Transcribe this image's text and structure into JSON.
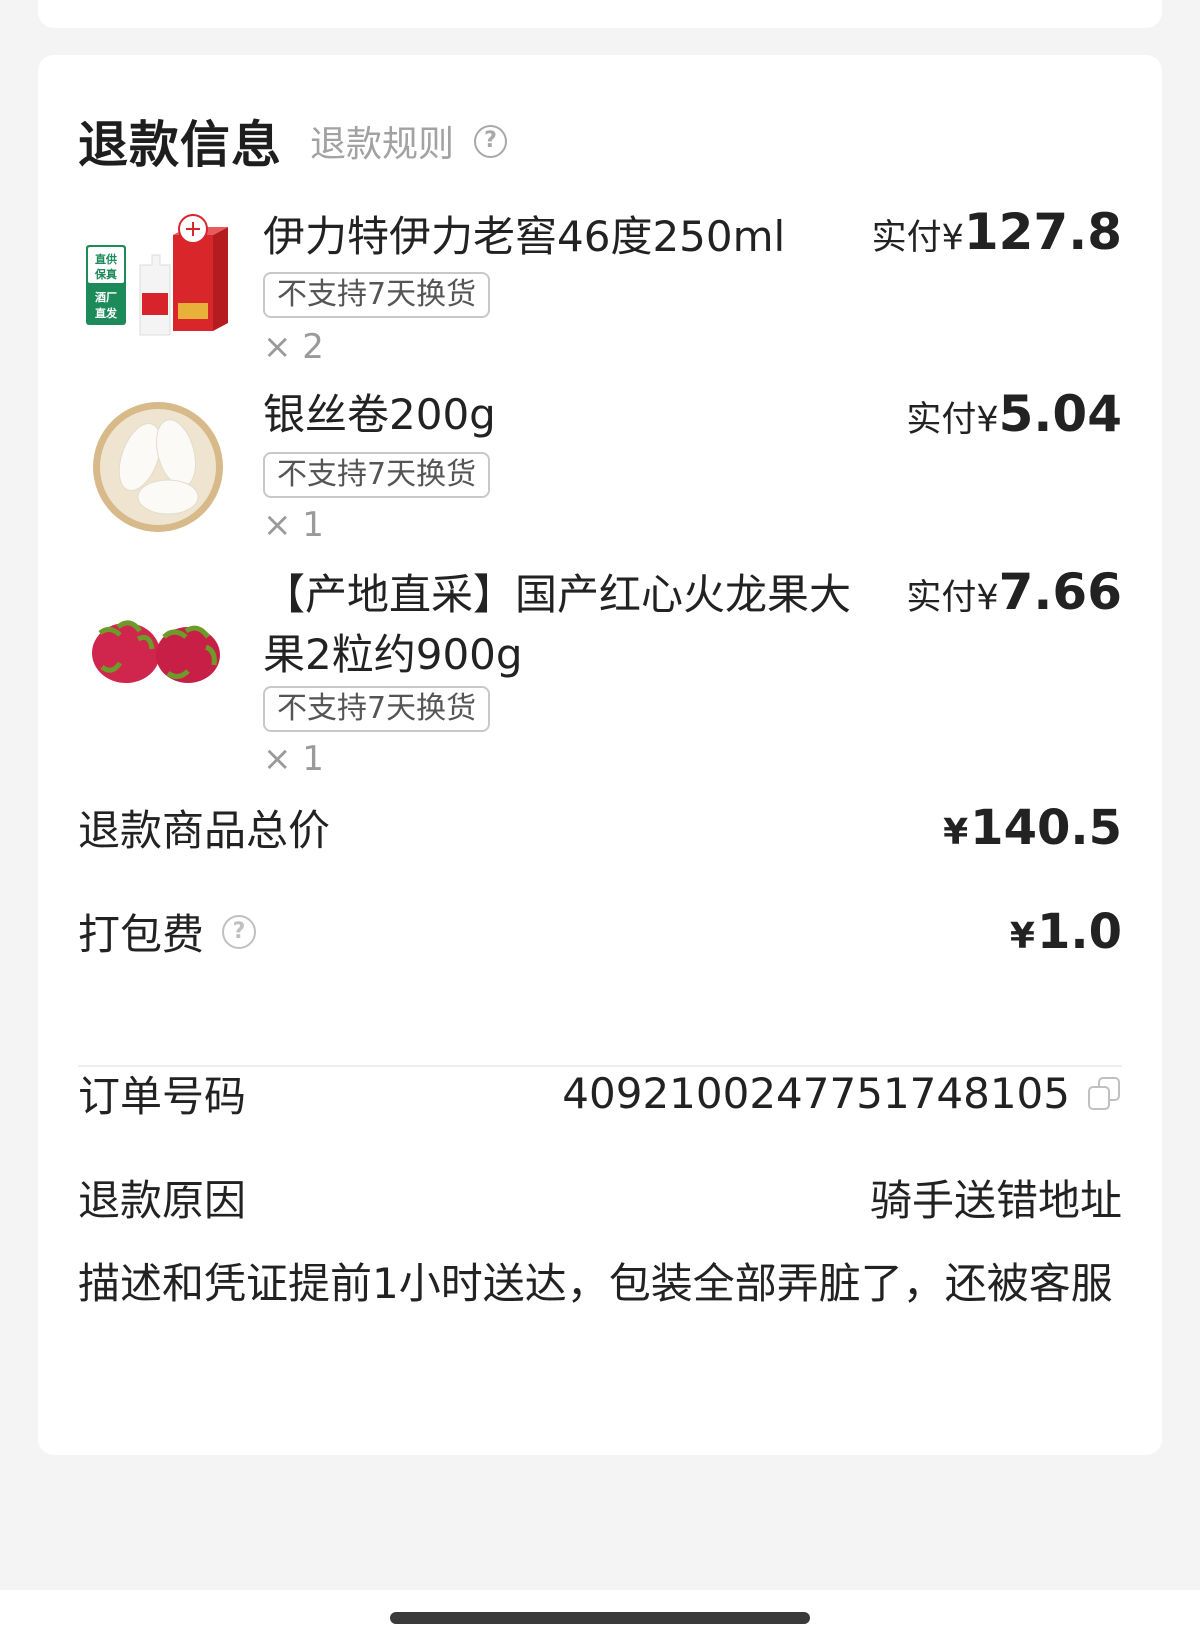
{
  "refund": {
    "title": "退款信息",
    "rules_link": "退款规则"
  },
  "items": [
    {
      "name": "伊力特伊力老窖46度250ml",
      "price_prefix": "实付¥",
      "price": "127.8",
      "tag": "不支持7天换货",
      "qty": "× 2",
      "thumb_badge": [
        "直供",
        "保真",
        "酒厂",
        "直发"
      ]
    },
    {
      "name": "银丝卷200g",
      "price_prefix": "实付¥",
      "price": "5.04",
      "tag": "不支持7天换货",
      "qty": "× 1"
    },
    {
      "name": "【产地直采】国产红心火龙果大果2粒约900g",
      "price_prefix": "实付¥",
      "price": "7.66",
      "tag": "不支持7天换货",
      "qty": "× 1"
    }
  ],
  "summary": {
    "total_label": "退款商品总价",
    "total_yen": "¥",
    "total_value": "140.5",
    "packing_label": "打包费",
    "packing_yen": "¥",
    "packing_value": "1.0"
  },
  "order": {
    "number_label": "订单号码",
    "number_value": "4092100247751748105",
    "reason_label": "退款原因",
    "reason_value": "骑手送错地址",
    "description": "描述和凭证提前1小时送达，包装全部弄脏了，还被客服"
  },
  "icons": {
    "help": "question-circle-icon",
    "copy": "copy-icon"
  }
}
